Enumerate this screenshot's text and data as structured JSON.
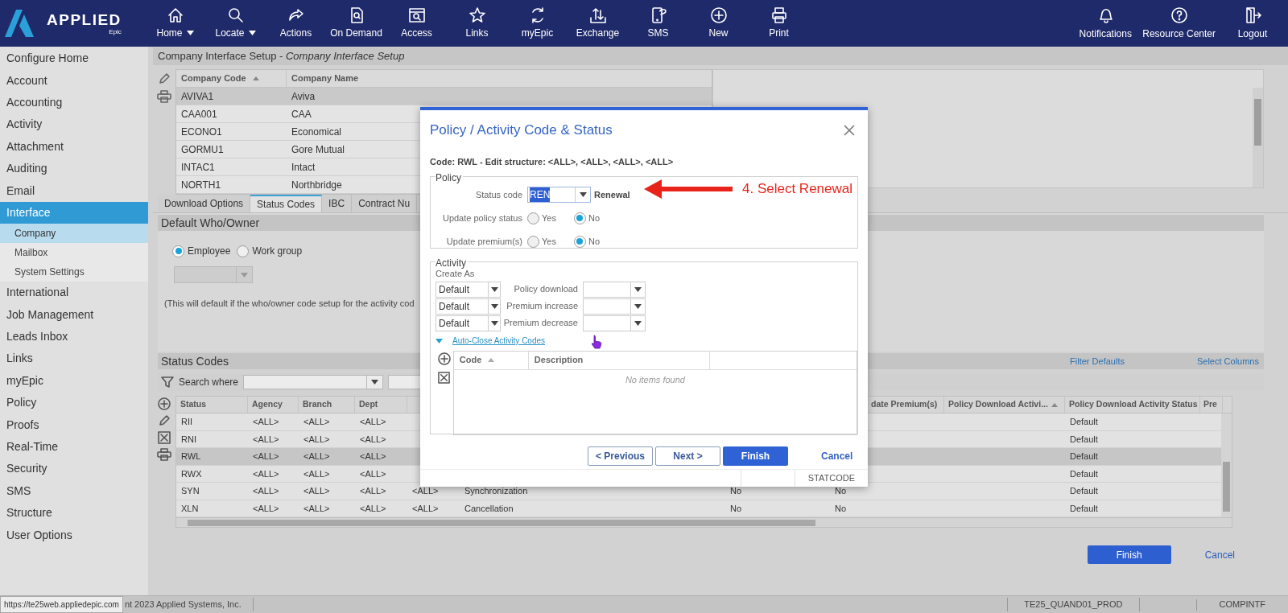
{
  "nav": {
    "logo": "APPLIED",
    "logo_sub": "Epic",
    "items": [
      {
        "label": "Home",
        "dropdown": true
      },
      {
        "label": "Locate",
        "dropdown": true
      },
      {
        "label": "Actions",
        "dropdown": false
      },
      {
        "label": "On Demand",
        "dropdown": false
      },
      {
        "label": "Access",
        "dropdown": false
      },
      {
        "label": "Links",
        "dropdown": false
      },
      {
        "label": "myEpic",
        "dropdown": false
      },
      {
        "label": "Exchange",
        "dropdown": false
      },
      {
        "label": "SMS",
        "dropdown": false
      },
      {
        "label": "New",
        "dropdown": false
      },
      {
        "label": "Print",
        "dropdown": false
      }
    ],
    "right_items": [
      {
        "label": "Notifications"
      },
      {
        "label": "Resource Center"
      },
      {
        "label": "Logout"
      }
    ]
  },
  "sidebar": {
    "items": [
      {
        "label": "Configure Home",
        "selected": false
      },
      {
        "label": "Account",
        "selected": false
      },
      {
        "label": "Accounting",
        "selected": false
      },
      {
        "label": "Activity",
        "selected": false
      },
      {
        "label": "Attachment",
        "selected": false
      },
      {
        "label": "Auditing",
        "selected": false
      },
      {
        "label": "Email",
        "selected": false
      },
      {
        "label": "Interface",
        "selected": true,
        "children": [
          {
            "label": "Company",
            "selected": true
          },
          {
            "label": "Mailbox",
            "selected": false
          },
          {
            "label": "System Settings",
            "selected": false
          }
        ]
      },
      {
        "label": "International",
        "selected": false
      },
      {
        "label": "Job Management",
        "selected": false
      },
      {
        "label": "Leads Inbox",
        "selected": false
      },
      {
        "label": "Links",
        "selected": false
      },
      {
        "label": "myEpic",
        "selected": false
      },
      {
        "label": "Policy",
        "selected": false
      },
      {
        "label": "Proofs",
        "selected": false
      },
      {
        "label": "Real-Time",
        "selected": false
      },
      {
        "label": "Security",
        "selected": false
      },
      {
        "label": "SMS",
        "selected": false
      },
      {
        "label": "Structure",
        "selected": false
      },
      {
        "label": "User Options",
        "selected": false
      }
    ]
  },
  "page_title": "Company Interface Setup - *Company Interface Setup*",
  "company_table": {
    "columns": [
      {
        "label": "Company Code",
        "sorted": true
      },
      {
        "label": "Company Name",
        "sorted": false
      }
    ],
    "rows": [
      {
        "code": "AVIVA1",
        "name": "Aviva",
        "selected": true
      },
      {
        "code": "CAA001",
        "name": "CAA",
        "selected": false
      },
      {
        "code": "ECONO1",
        "name": "Economical",
        "selected": false
      },
      {
        "code": "GORMU1",
        "name": "Gore Mutual",
        "selected": false
      },
      {
        "code": "INTAC1",
        "name": "Intact",
        "selected": false
      },
      {
        "code": "NORTH1",
        "name": "Northbridge",
        "selected": false
      }
    ]
  },
  "tabs": [
    {
      "label": "Download Options",
      "selected": false
    },
    {
      "label": "Status Codes",
      "selected": true
    },
    {
      "label": "IBC",
      "selected": false
    },
    {
      "label": "Contract Nu",
      "selected": false
    }
  ],
  "default_owner": {
    "title": "Default Who/Owner",
    "options": [
      {
        "label": "Employee",
        "selected": true
      },
      {
        "label": "Work group",
        "selected": false
      }
    ],
    "dropdown_disabled": true,
    "note": "(This will default if the who/owner code setup for the activity cod"
  },
  "status_codes": {
    "title": "Status Codes",
    "links": [
      "Filter Defaults",
      "Select Columns"
    ],
    "search_label": "Search where",
    "columns": [
      {
        "label": "Status",
        "sorted": false
      },
      {
        "label": "Agency",
        "sorted": false
      },
      {
        "label": "Branch",
        "sorted": false
      },
      {
        "label": "Dept",
        "sorted": false
      },
      {
        "label": "date Premium(s)",
        "sorted": false
      },
      {
        "label": "Policy Download Activi...",
        "sorted": true
      },
      {
        "label": "Policy Download Activity Status",
        "sorted": false
      },
      {
        "label": "Pre",
        "sorted": false
      }
    ],
    "rows": [
      {
        "status": "RII",
        "agency": "<ALL>",
        "branch": "<ALL>",
        "dept": "<ALL>",
        "policy_download_activity_status": "Default",
        "selected": false
      },
      {
        "status": "RNI",
        "agency": "<ALL>",
        "branch": "<ALL>",
        "dept": "<ALL>",
        "policy_download_activity_status": "Default",
        "selected": false
      },
      {
        "status": "RWL",
        "agency": "<ALL>",
        "branch": "<ALL>",
        "dept": "<ALL>",
        "policy_download_activity_status": "Default",
        "selected": true
      },
      {
        "status": "RWX",
        "agency": "<ALL>",
        "branch": "<ALL>",
        "dept": "<ALL>",
        "policy_download_activity_status": "Default",
        "selected": false
      },
      {
        "status": "SYN",
        "agency": "<ALL>",
        "branch": "<ALL>",
        "dept": "<ALL>",
        "column_5": "<ALL>",
        "description": "Synchronization",
        "column_7": "No",
        "update_premiums": "No",
        "policy_download_activity_status": "Default",
        "selected": false
      },
      {
        "status": "XLN",
        "agency": "<ALL>",
        "branch": "<ALL>",
        "dept": "<ALL>",
        "column_5": "<ALL>",
        "description": "Cancellation",
        "column_7": "No",
        "update_premiums": "No",
        "policy_download_activity_status": "Default",
        "selected": false
      }
    ]
  },
  "footer_buttons": [
    {
      "label": "Finish",
      "kind": "primary"
    },
    {
      "label": "Cancel",
      "kind": "link"
    }
  ],
  "status_bar": {
    "url_tooltip": "https://te25web.appliedepic.com",
    "copyright": "nt 2023 Applied Systems, Inc.",
    "environment": "TE25_QUAND01_PROD",
    "code": "COMPINTF"
  },
  "dialog": {
    "title": "Policy / Activity Code & Status",
    "code_line": "Code: RWL - Edit structure: <ALL>, <ALL>, <ALL>, <ALL>",
    "policy": {
      "title": "Policy",
      "status_code_label": "Status code",
      "status_code": "REN",
      "status_code_highlighted": true,
      "status_code_name": "Renewal",
      "radio_rows": [
        {
          "label": "Update policy status",
          "options": [
            {
              "label": "Yes",
              "selected": false
            },
            {
              "label": "No",
              "selected": true
            }
          ]
        },
        {
          "label": "Update premium(s)",
          "options": [
            {
              "label": "Yes",
              "selected": false
            },
            {
              "label": "No",
              "selected": true
            }
          ]
        }
      ]
    },
    "activity": {
      "title": "Activity",
      "create_as_label": "Create As",
      "rows": [
        {
          "create_as": "Default",
          "label": "Policy download"
        },
        {
          "create_as": "Default",
          "label": "Premium increase"
        },
        {
          "create_as": "Default",
          "label": "Premium decrease"
        }
      ],
      "link": {
        "label": "Auto-Close Activity Codes",
        "expanded": true
      },
      "table": {
        "columns": [
          {
            "label": "Code",
            "sorted": true
          },
          {
            "label": "Description",
            "sorted": false
          }
        ],
        "empty_message": "No items found"
      }
    },
    "buttons": [
      {
        "label": "< Previous",
        "kind": "secondary"
      },
      {
        "label": "Next >",
        "kind": "secondary"
      },
      {
        "label": "Finish",
        "kind": "primary"
      },
      {
        "label": "Cancel",
        "kind": "link"
      }
    ],
    "footer_code": "STATCODE"
  },
  "annotation": {
    "text": "4. Select Renewal"
  }
}
